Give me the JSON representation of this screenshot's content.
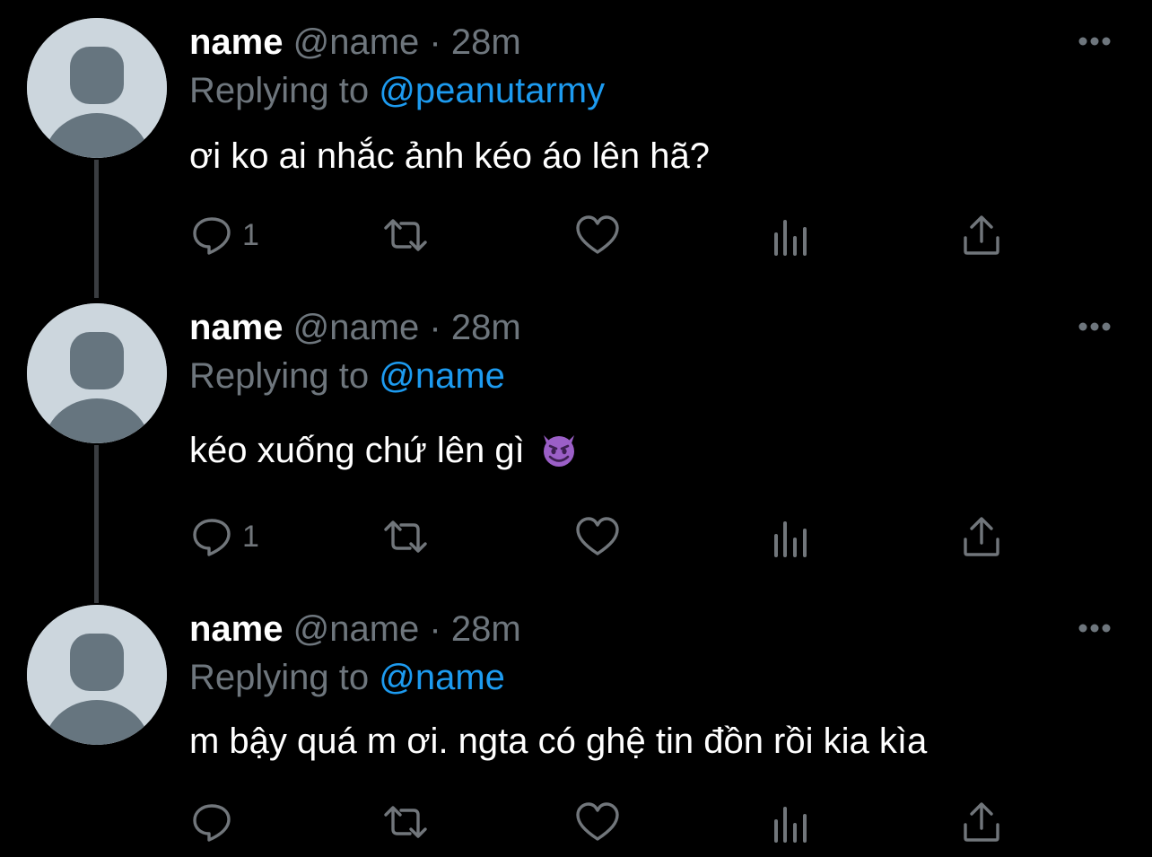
{
  "tweets": [
    {
      "display_name": "name",
      "handle": "@name",
      "separator": "·",
      "time": "28m",
      "replying_prefix": "Replying to",
      "replying_to": "@peanutarmy",
      "text": "ơi ko ai nhắc ảnh kéo áo lên hã?",
      "reply_count": "1",
      "emoji": ""
    },
    {
      "display_name": "name",
      "handle": "@name",
      "separator": "·",
      "time": "28m",
      "replying_prefix": "Replying to",
      "replying_to": "@name",
      "text": "kéo xuống chứ lên gì",
      "reply_count": "1",
      "emoji": "smiling-imp"
    },
    {
      "display_name": "name",
      "handle": "@name",
      "separator": "·",
      "time": "28m",
      "replying_prefix": "Replying to",
      "replying_to": "@name",
      "text": "m bậy quá m ơi. ngta có ghệ tin đồn rồi kia kìa",
      "reply_count": "",
      "emoji": ""
    }
  ],
  "icons": {
    "reply": "reply-bubble-icon",
    "retweet": "retweet-icon",
    "like": "heart-icon",
    "views": "bar-chart-icon",
    "share": "share-icon",
    "more": "more-dots-icon"
  },
  "colors": {
    "background": "#000000",
    "name": "#ffffff",
    "muted": "#6e767d",
    "link": "#1d9bf0",
    "avatar_bg": "#ccd6dd",
    "avatar_fg": "#66757f",
    "thread_line": "#3a3d41"
  }
}
